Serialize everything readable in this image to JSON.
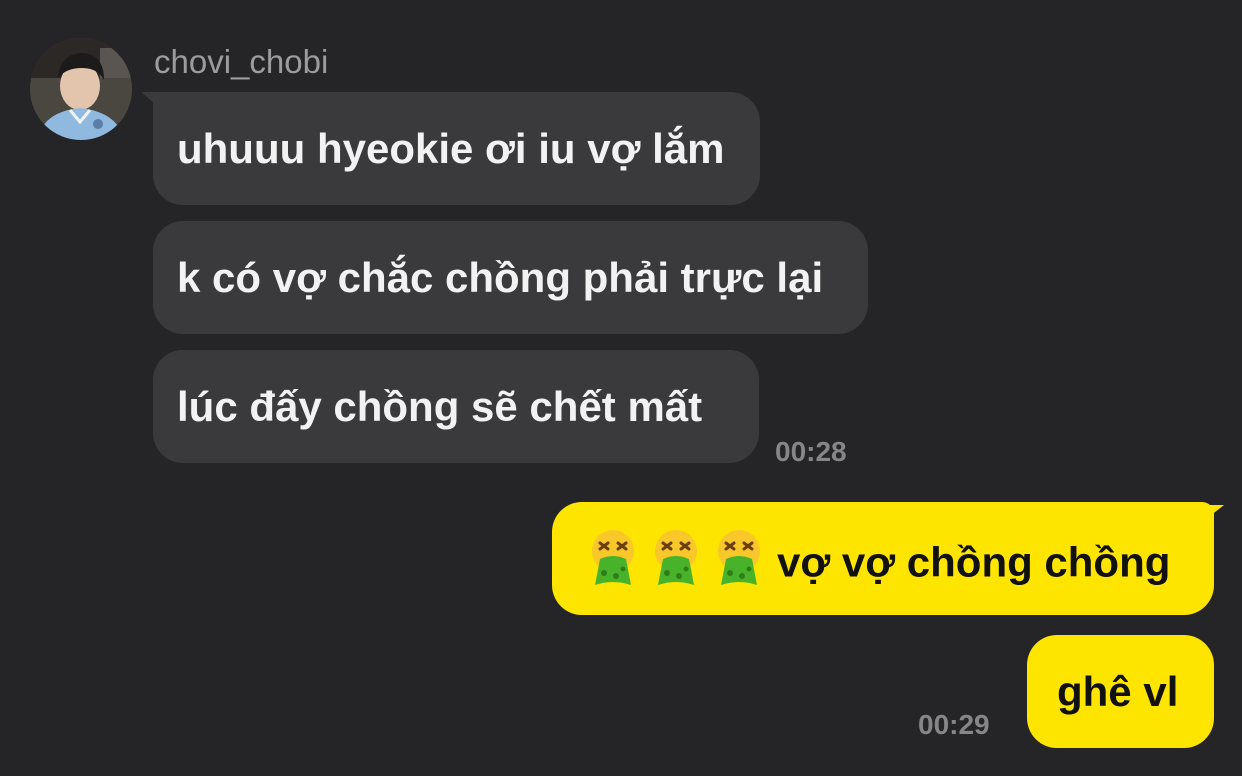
{
  "chat": {
    "sender": {
      "name": "chovi_chobi",
      "avatar_icon": "profile-photo"
    },
    "incoming": [
      {
        "text": "uhuuu hyeokie ơi iu vợ lắm"
      },
      {
        "text": "k có vợ chắc chồng phải trực lại"
      },
      {
        "text": "lúc đấy chồng sẽ chết mất"
      }
    ],
    "incoming_time": "00:28",
    "outgoing": [
      {
        "emoji_icon": "vomiting-face-emoji",
        "text": "vợ vợ chồng chồng"
      },
      {
        "text": "ghê vl"
      }
    ],
    "outgoing_time": "00:29"
  },
  "colors": {
    "background": "#252527",
    "incoming_bubble": "#3a3a3c",
    "outgoing_bubble": "#fee500",
    "timestamp": "#86868a"
  }
}
